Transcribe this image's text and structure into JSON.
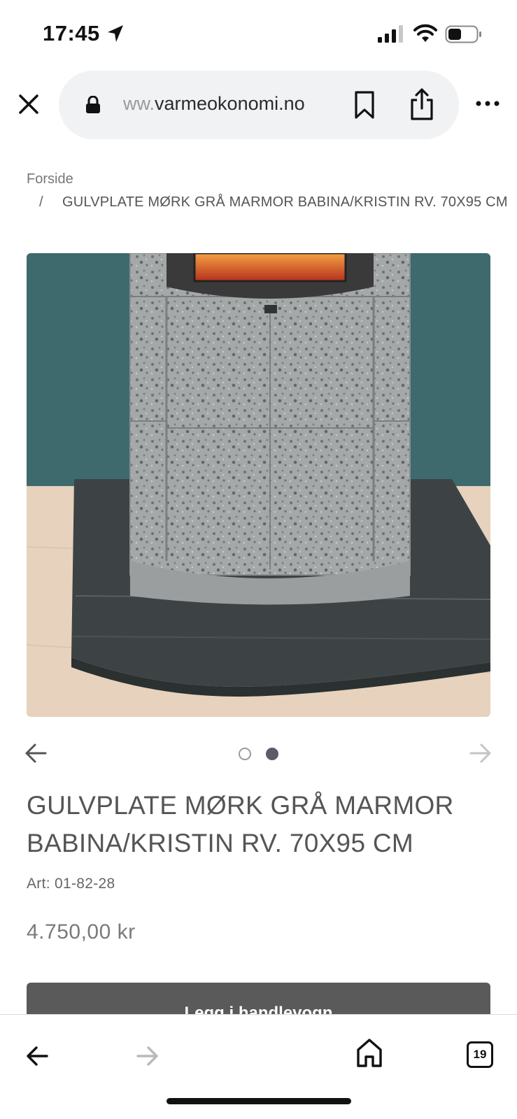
{
  "status": {
    "time": "17:45"
  },
  "browser": {
    "url_faded": "ww.",
    "url_main": "varmeokonomi.no",
    "tab_count": "19"
  },
  "breadcrumb": {
    "home": "Forside",
    "separator": "/",
    "current": "GULVPLATE MØRK GRÅ MARMOR BABINA/KRISTIN RV. 70X95 CM"
  },
  "carousel": {
    "slide_count": 2,
    "active_slide": 2
  },
  "product": {
    "title": "GULVPLATE MØRK GRÅ MARMOR BABINA/KRISTIN RV. 70X95 CM",
    "art": "Art: 01-82-28",
    "price": "4.750,00 kr",
    "add_to_cart": "Legg i handlevogn"
  },
  "colors": {
    "wall": "#3e6a6e",
    "floor": "#e6d2bd",
    "stone": "#9ea1a1",
    "floor_plate": "#3d4345",
    "button": "#5a5a5a"
  }
}
